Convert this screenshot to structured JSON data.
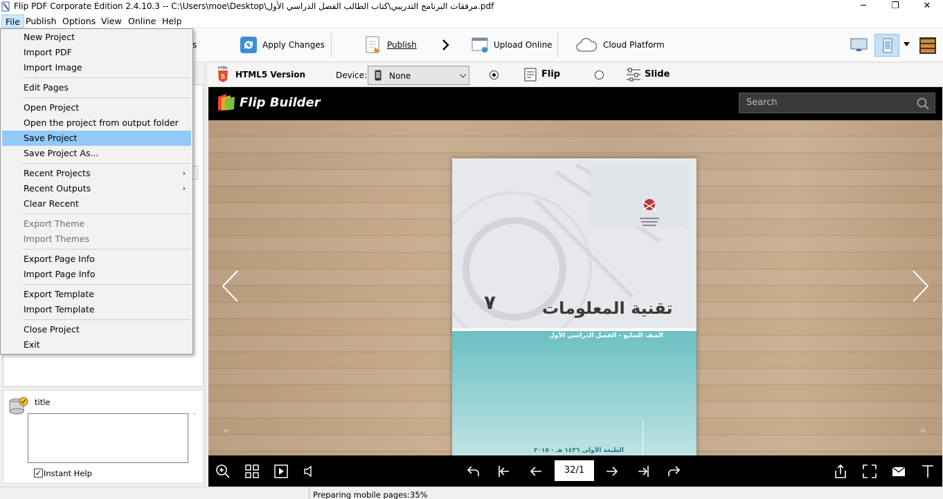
{
  "titlebar": {
    "title": "Flip PDF Corporate Edition 2.4.10.3 -- C:\\Users\\moe\\Desktop\\مرفقات البرنامج التدريبي\\كتاب الطالب الفصل الدراسي الأول.pdf",
    "minimize": "─",
    "maximize": "❐",
    "close": "✕"
  },
  "menubar": {
    "items": [
      "File",
      "Publish",
      "Options",
      "View",
      "Online",
      "Help"
    ]
  },
  "toolbar": {
    "apply": "Apply Changes",
    "publish": "Publish",
    "upload": "Upload Online",
    "cloud": "Cloud Platform",
    "partial": "s"
  },
  "file_menu": {
    "items": [
      {
        "label": "New Project",
        "type": "item"
      },
      {
        "label": "Import PDF",
        "type": "item"
      },
      {
        "label": "Import Image",
        "type": "item"
      },
      {
        "type": "sep"
      },
      {
        "label": "Edit Pages",
        "type": "item"
      },
      {
        "type": "sep"
      },
      {
        "label": "Open Project",
        "type": "item"
      },
      {
        "label": "Open the project from output folder",
        "type": "item"
      },
      {
        "label": "Save Project",
        "type": "item",
        "highlighted": true
      },
      {
        "label": "Save Project As...",
        "type": "item"
      },
      {
        "type": "sep"
      },
      {
        "label": "Recent Projects",
        "type": "item",
        "submenu": true
      },
      {
        "label": "Recent Outputs",
        "type": "item",
        "submenu": true
      },
      {
        "label": "Clear Recent",
        "type": "item"
      },
      {
        "type": "sep"
      },
      {
        "label": "Export Theme",
        "type": "item",
        "disabled": true
      },
      {
        "label": "Import Themes",
        "type": "item",
        "disabled": true
      },
      {
        "type": "sep"
      },
      {
        "label": "Export Page Info",
        "type": "item"
      },
      {
        "label": "Import Page Info",
        "type": "item"
      },
      {
        "type": "sep"
      },
      {
        "label": "Export Template",
        "type": "item"
      },
      {
        "label": "Import Template",
        "type": "item"
      },
      {
        "type": "sep"
      },
      {
        "label": "Close Project",
        "type": "item"
      },
      {
        "label": "Exit",
        "type": "item"
      }
    ]
  },
  "help_panel": {
    "title": "title",
    "instant_help": "Instant Help"
  },
  "h5bar": {
    "version": "HTML5 Version",
    "device_label": "Device:",
    "device_value": "None",
    "flip": "Flip",
    "slide": "Slide",
    "html_badge": "HTML"
  },
  "viewer": {
    "brand": "Flip Builder",
    "search_placeholder": "Search",
    "page_indicator": "32/1"
  },
  "book": {
    "title": "تقنية المعلومات",
    "number": "٧",
    "subtitle": "الصف السابع - الفصل الدراسي الأول",
    "edition": "الطبعة الأولى ١٤٣٦ هـ - ٢٠١٥ م"
  },
  "status": {
    "text": "Preparing mobile pages:35%"
  },
  "colors": {
    "accent": "#91c9f7",
    "viewer_bg": "#000000",
    "book_teal": "#6fc3c6"
  }
}
